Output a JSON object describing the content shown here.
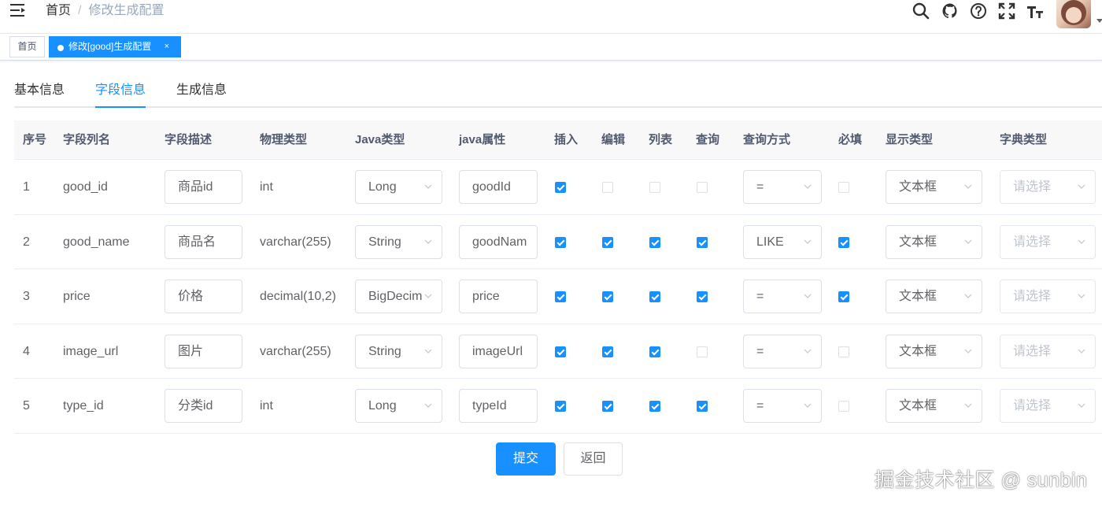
{
  "breadcrumb": {
    "home": "首页",
    "separator": "/",
    "current": "修改生成配置"
  },
  "right_menu": {
    "icons": [
      "search-icon",
      "github-icon",
      "question-icon",
      "fullscreen-icon",
      "font-size-icon"
    ]
  },
  "tags": {
    "home": "首页",
    "active": "修改[good]生成配置",
    "close": "×"
  },
  "tabs": [
    {
      "label": "基本信息"
    },
    {
      "label": "字段信息",
      "active": true
    },
    {
      "label": "生成信息"
    }
  ],
  "table": {
    "headers": [
      "序号",
      "字段列名",
      "字段描述",
      "物理类型",
      "Java类型",
      "java属性",
      "插入",
      "编辑",
      "列表",
      "查询",
      "查询方式",
      "必填",
      "显示类型",
      "字典类型"
    ],
    "rows": [
      {
        "no": "1",
        "column": "good_id",
        "desc": "商品id",
        "phys": "int",
        "javaType": "Long",
        "javaField": "goodId",
        "insert": true,
        "edit": false,
        "list": false,
        "query": false,
        "queryType": "=",
        "required": false,
        "htmlType": "文本框",
        "dict": "请选择"
      },
      {
        "no": "2",
        "column": "good_name",
        "desc": "商品名",
        "phys": "varchar(255)",
        "javaType": "String",
        "javaField": "goodNam",
        "insert": true,
        "edit": true,
        "list": true,
        "query": true,
        "queryType": "LIKE",
        "required": true,
        "htmlType": "文本框",
        "dict": "请选择"
      },
      {
        "no": "3",
        "column": "price",
        "desc": "价格",
        "phys": "decimal(10,2)",
        "javaType": "BigDecim",
        "javaField": "price",
        "insert": true,
        "edit": true,
        "list": true,
        "query": true,
        "queryType": "=",
        "required": true,
        "htmlType": "文本框",
        "dict": "请选择"
      },
      {
        "no": "4",
        "column": "image_url",
        "desc": "图片",
        "phys": "varchar(255)",
        "javaType": "String",
        "javaField": "imageUrl",
        "insert": true,
        "edit": true,
        "list": true,
        "query": false,
        "queryType": "=",
        "required": false,
        "htmlType": "文本框",
        "dict": "请选择"
      },
      {
        "no": "5",
        "column": "type_id",
        "desc": "分类id",
        "phys": "int",
        "javaType": "Long",
        "javaField": "typeId",
        "insert": true,
        "edit": true,
        "list": true,
        "query": true,
        "queryType": "=",
        "required": false,
        "htmlType": "文本框",
        "dict": "请选择"
      }
    ]
  },
  "buttons": {
    "submit": "提交",
    "back": "返回"
  },
  "watermark": "掘金技术社区 @ sunbin",
  "colors": {
    "primary": "#1890ff",
    "header_bg": "#f8f8f9",
    "border": "#dcdfe6",
    "placeholder": "#c0c4cc"
  }
}
